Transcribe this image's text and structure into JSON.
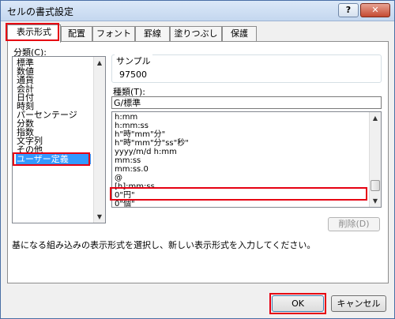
{
  "window": {
    "title": "セルの書式設定",
    "help_glyph": "?",
    "close_glyph": "✕"
  },
  "tabs": [
    {
      "label": "表示形式"
    },
    {
      "label": "配置"
    },
    {
      "label": "フォント"
    },
    {
      "label": "罫線"
    },
    {
      "label": "塗りつぶし"
    },
    {
      "label": "保護"
    }
  ],
  "category": {
    "label": "分類(C):",
    "items": [
      "標準",
      "数値",
      "通貨",
      "会計",
      "日付",
      "時刻",
      "パーセンテージ",
      "分数",
      "指数",
      "文字列",
      "その他",
      "ユーザー定義"
    ],
    "selected": "ユーザー定義"
  },
  "sample": {
    "label": "サンプル",
    "value": "97500"
  },
  "type": {
    "label": "種類(T):",
    "value": "G/標準"
  },
  "formats": [
    "h:mm",
    "h:mm:ss",
    "h\"時\"mm\"分\"",
    "h\"時\"mm\"分\"ss\"秒\"",
    "yyyy/m/d h:mm",
    "mm:ss",
    "mm:ss.0",
    "@",
    "[h]:mm:ss",
    "0\"円\"",
    "0\"個\""
  ],
  "highlighted_format": "0\"円\"",
  "buttons": {
    "delete": "削除(D)",
    "ok": "OK",
    "cancel": "キャンセル"
  },
  "description": "基になる組み込みの表示形式を選択し、新しい表示形式を入力してください。",
  "colors": {
    "highlight_red": "#e60012",
    "selection_blue": "#3399ff"
  }
}
